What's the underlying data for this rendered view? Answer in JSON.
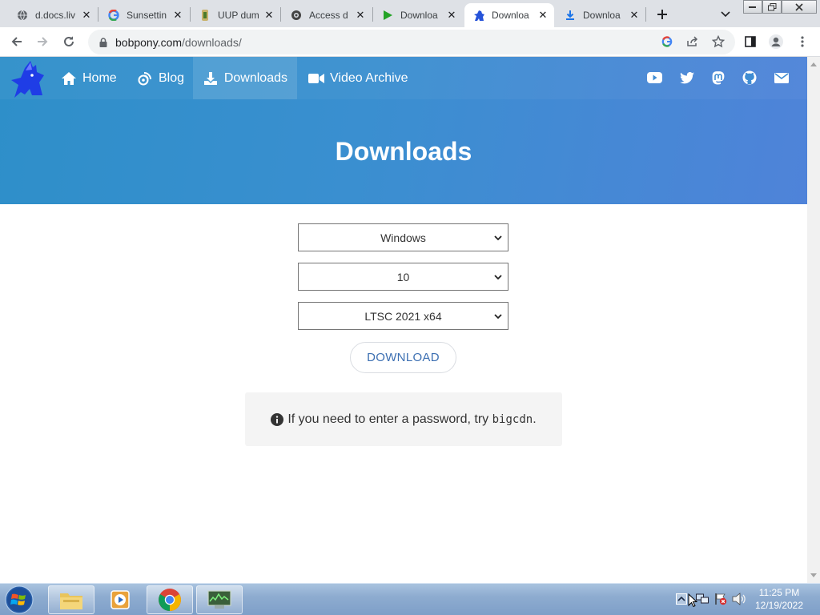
{
  "browser": {
    "tabs": [
      {
        "title": "d.docs.liv",
        "icon": "globe-icon",
        "active": false
      },
      {
        "title": "Sunsettin",
        "icon": "google-icon",
        "active": false
      },
      {
        "title": "UUP dum",
        "icon": "uup-icon",
        "active": false
      },
      {
        "title": "Access d",
        "icon": "access-icon",
        "active": false
      },
      {
        "title": "Downloa",
        "icon": "play-icon",
        "active": false
      },
      {
        "title": "Downloa",
        "icon": "bobpony-icon",
        "active": true
      },
      {
        "title": "Downloa",
        "icon": "download-icon",
        "active": false
      }
    ],
    "url_host": "bobpony.com",
    "url_path": "/downloads/"
  },
  "site": {
    "nav": [
      {
        "label": "Home",
        "icon": "home-icon"
      },
      {
        "label": "Blog",
        "icon": "blog-icon"
      },
      {
        "label": "Downloads",
        "icon": "download-icon",
        "active": true
      },
      {
        "label": "Video Archive",
        "icon": "video-icon"
      }
    ],
    "social": [
      "youtube-icon",
      "twitter-icon",
      "mastodon-icon",
      "github-icon",
      "mail-icon"
    ],
    "hero_title": "Downloads",
    "selects": {
      "os": "Windows",
      "version": "10",
      "edition": "LTSC 2021 x64"
    },
    "download_button": "DOWNLOAD",
    "notice": {
      "text": "If you need to enter a password, try",
      "code": "bigcdn",
      "end": "."
    }
  },
  "taskbar": {
    "time": "11:25 PM",
    "date": "12/19/2022",
    "apps": [
      "explorer-icon",
      "media-player-icon",
      "chrome-icon",
      "task-manager-icon"
    ]
  },
  "colors": {
    "hero_start": "#2e8fc9",
    "hero_end": "#4f83d9",
    "button_text": "#3c6fb2"
  }
}
